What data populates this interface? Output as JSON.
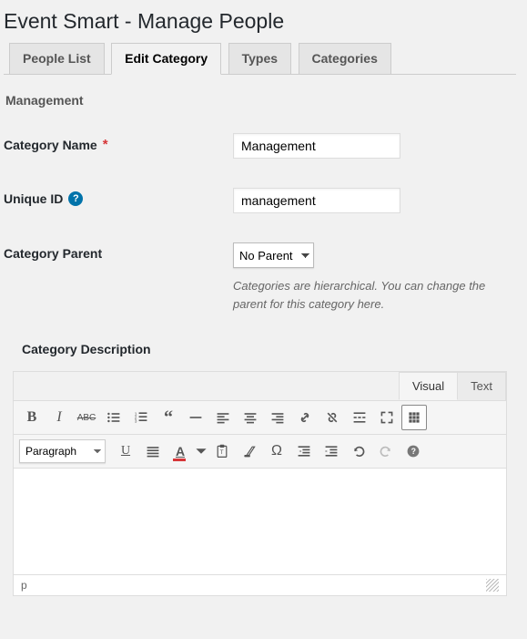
{
  "page": {
    "title": "Event Smart - Manage People"
  },
  "tabs": [
    {
      "label": "People List",
      "active": false
    },
    {
      "label": "Edit Category",
      "active": true
    },
    {
      "label": "Types",
      "active": false
    },
    {
      "label": "Categories",
      "active": false
    }
  ],
  "section_header": "Management",
  "form": {
    "category_name": {
      "label": "Category Name",
      "required": "*",
      "value": "Management"
    },
    "unique_id": {
      "label": "Unique ID",
      "has_help": true,
      "value": "management"
    },
    "category_parent": {
      "label": "Category Parent",
      "selected": "No Parent",
      "options": [
        "No Parent"
      ],
      "hint": "Categories are hierarchical. You can change the parent for this category here."
    }
  },
  "editor": {
    "label": "Category Description",
    "tabs": {
      "visual": "Visual",
      "text": "Text",
      "active": "visual"
    },
    "format_selected": "Paragraph",
    "format_options": [
      "Paragraph"
    ],
    "content": "",
    "status_path": "p",
    "toolbar_row1": [
      "bold",
      "italic",
      "strike",
      "ul",
      "ol",
      "quote",
      "hr",
      "align-left",
      "align-center",
      "align-right",
      "link",
      "unlink",
      "more",
      "fullscreen",
      "toggle"
    ],
    "toolbar_row2": [
      "format",
      "underline",
      "justify",
      "textcolor",
      "paste",
      "clear",
      "char",
      "outdent",
      "indent",
      "undo",
      "redo",
      "help"
    ]
  }
}
